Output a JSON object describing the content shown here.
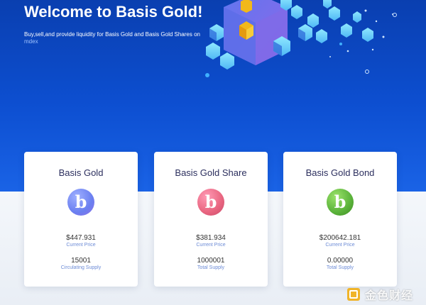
{
  "hero": {
    "title": "Welcome to Basis Gold!",
    "subtitle": "Buy,sell,and provide liquidity for Basis Gold and Basis Gold Shares on",
    "link": "mdex"
  },
  "cards": [
    {
      "title": "Basis Gold",
      "icon_letter": "b",
      "icon_color": "#7b8df0",
      "price": "$447.931",
      "price_label": "Current Price",
      "supply": "15001",
      "supply_label": "Circulating Supply"
    },
    {
      "title": "Basis Gold Share",
      "icon_letter": "b",
      "icon_color": "#e86a8e",
      "price": "$381.934",
      "price_label": "Current Price",
      "supply": "1000001",
      "supply_label": "Total Supply"
    },
    {
      "title": "Basis Gold Bond",
      "icon_letter": "b",
      "icon_color": "#5ab23a",
      "price": "$200642.181",
      "price_label": "Current Price",
      "supply": "0.00000",
      "supply_label": "Total Supply"
    }
  ],
  "watermark": {
    "text": "金色财经"
  },
  "colors": {
    "hero_bg": "#0d4fd1",
    "link": "#9fc2ff",
    "label": "#6c8bd6"
  }
}
